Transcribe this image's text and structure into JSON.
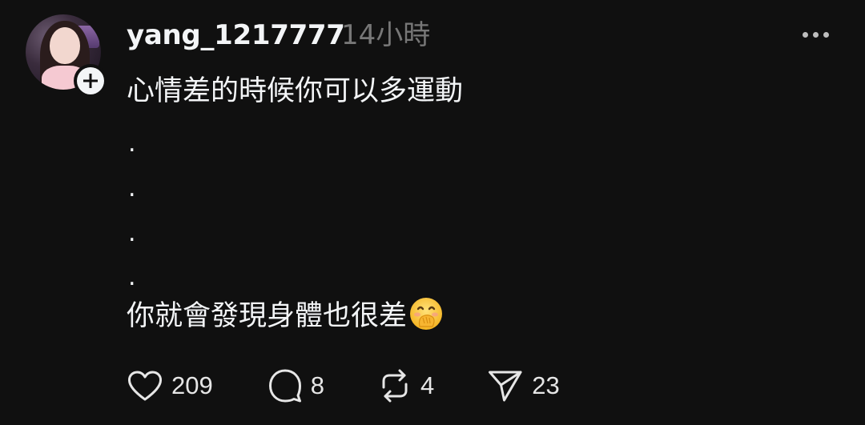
{
  "post": {
    "author": "yang_1217777",
    "time": "14小時",
    "lines": {
      "line1": "心情差的時候你可以多運動",
      "dot1": ".",
      "dot2": ".",
      "dot3": ".",
      "dot4": ".",
      "line2": "你就會發現身體也很差"
    },
    "emoji": "face-with-hand-over-mouth"
  },
  "actions": {
    "likes": "209",
    "replies": "8",
    "reposts": "4",
    "shares": "23"
  },
  "colors": {
    "background": "#101010",
    "text": "#f3f5f7",
    "muted": "#777777"
  }
}
